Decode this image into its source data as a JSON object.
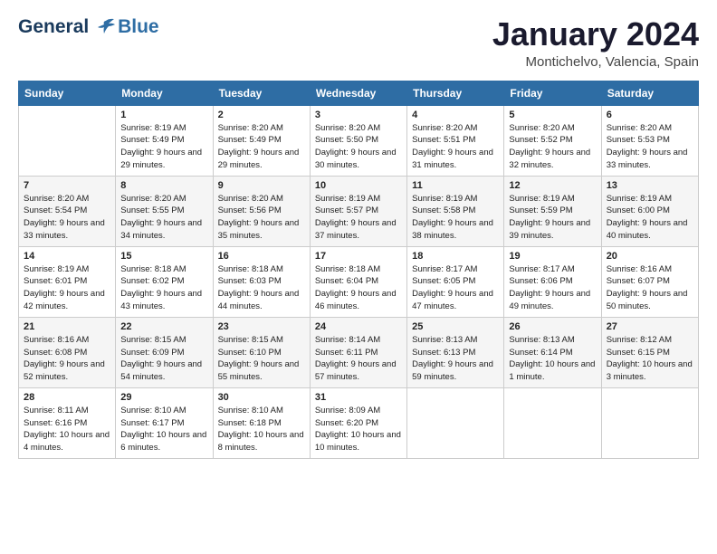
{
  "logo": {
    "line1": "General",
    "line2": "Blue"
  },
  "title": "January 2024",
  "subtitle": "Montichelvo, Valencia, Spain",
  "days_of_week": [
    "Sunday",
    "Monday",
    "Tuesday",
    "Wednesday",
    "Thursday",
    "Friday",
    "Saturday"
  ],
  "weeks": [
    [
      {
        "num": "",
        "sunrise": "",
        "sunset": "",
        "daylight": ""
      },
      {
        "num": "1",
        "sunrise": "Sunrise: 8:19 AM",
        "sunset": "Sunset: 5:49 PM",
        "daylight": "Daylight: 9 hours and 29 minutes."
      },
      {
        "num": "2",
        "sunrise": "Sunrise: 8:20 AM",
        "sunset": "Sunset: 5:49 PM",
        "daylight": "Daylight: 9 hours and 29 minutes."
      },
      {
        "num": "3",
        "sunrise": "Sunrise: 8:20 AM",
        "sunset": "Sunset: 5:50 PM",
        "daylight": "Daylight: 9 hours and 30 minutes."
      },
      {
        "num": "4",
        "sunrise": "Sunrise: 8:20 AM",
        "sunset": "Sunset: 5:51 PM",
        "daylight": "Daylight: 9 hours and 31 minutes."
      },
      {
        "num": "5",
        "sunrise": "Sunrise: 8:20 AM",
        "sunset": "Sunset: 5:52 PM",
        "daylight": "Daylight: 9 hours and 32 minutes."
      },
      {
        "num": "6",
        "sunrise": "Sunrise: 8:20 AM",
        "sunset": "Sunset: 5:53 PM",
        "daylight": "Daylight: 9 hours and 33 minutes."
      }
    ],
    [
      {
        "num": "7",
        "sunrise": "Sunrise: 8:20 AM",
        "sunset": "Sunset: 5:54 PM",
        "daylight": "Daylight: 9 hours and 33 minutes."
      },
      {
        "num": "8",
        "sunrise": "Sunrise: 8:20 AM",
        "sunset": "Sunset: 5:55 PM",
        "daylight": "Daylight: 9 hours and 34 minutes."
      },
      {
        "num": "9",
        "sunrise": "Sunrise: 8:20 AM",
        "sunset": "Sunset: 5:56 PM",
        "daylight": "Daylight: 9 hours and 35 minutes."
      },
      {
        "num": "10",
        "sunrise": "Sunrise: 8:19 AM",
        "sunset": "Sunset: 5:57 PM",
        "daylight": "Daylight: 9 hours and 37 minutes."
      },
      {
        "num": "11",
        "sunrise": "Sunrise: 8:19 AM",
        "sunset": "Sunset: 5:58 PM",
        "daylight": "Daylight: 9 hours and 38 minutes."
      },
      {
        "num": "12",
        "sunrise": "Sunrise: 8:19 AM",
        "sunset": "Sunset: 5:59 PM",
        "daylight": "Daylight: 9 hours and 39 minutes."
      },
      {
        "num": "13",
        "sunrise": "Sunrise: 8:19 AM",
        "sunset": "Sunset: 6:00 PM",
        "daylight": "Daylight: 9 hours and 40 minutes."
      }
    ],
    [
      {
        "num": "14",
        "sunrise": "Sunrise: 8:19 AM",
        "sunset": "Sunset: 6:01 PM",
        "daylight": "Daylight: 9 hours and 42 minutes."
      },
      {
        "num": "15",
        "sunrise": "Sunrise: 8:18 AM",
        "sunset": "Sunset: 6:02 PM",
        "daylight": "Daylight: 9 hours and 43 minutes."
      },
      {
        "num": "16",
        "sunrise": "Sunrise: 8:18 AM",
        "sunset": "Sunset: 6:03 PM",
        "daylight": "Daylight: 9 hours and 44 minutes."
      },
      {
        "num": "17",
        "sunrise": "Sunrise: 8:18 AM",
        "sunset": "Sunset: 6:04 PM",
        "daylight": "Daylight: 9 hours and 46 minutes."
      },
      {
        "num": "18",
        "sunrise": "Sunrise: 8:17 AM",
        "sunset": "Sunset: 6:05 PM",
        "daylight": "Daylight: 9 hours and 47 minutes."
      },
      {
        "num": "19",
        "sunrise": "Sunrise: 8:17 AM",
        "sunset": "Sunset: 6:06 PM",
        "daylight": "Daylight: 9 hours and 49 minutes."
      },
      {
        "num": "20",
        "sunrise": "Sunrise: 8:16 AM",
        "sunset": "Sunset: 6:07 PM",
        "daylight": "Daylight: 9 hours and 50 minutes."
      }
    ],
    [
      {
        "num": "21",
        "sunrise": "Sunrise: 8:16 AM",
        "sunset": "Sunset: 6:08 PM",
        "daylight": "Daylight: 9 hours and 52 minutes."
      },
      {
        "num": "22",
        "sunrise": "Sunrise: 8:15 AM",
        "sunset": "Sunset: 6:09 PM",
        "daylight": "Daylight: 9 hours and 54 minutes."
      },
      {
        "num": "23",
        "sunrise": "Sunrise: 8:15 AM",
        "sunset": "Sunset: 6:10 PM",
        "daylight": "Daylight: 9 hours and 55 minutes."
      },
      {
        "num": "24",
        "sunrise": "Sunrise: 8:14 AM",
        "sunset": "Sunset: 6:11 PM",
        "daylight": "Daylight: 9 hours and 57 minutes."
      },
      {
        "num": "25",
        "sunrise": "Sunrise: 8:13 AM",
        "sunset": "Sunset: 6:13 PM",
        "daylight": "Daylight: 9 hours and 59 minutes."
      },
      {
        "num": "26",
        "sunrise": "Sunrise: 8:13 AM",
        "sunset": "Sunset: 6:14 PM",
        "daylight": "Daylight: 10 hours and 1 minute."
      },
      {
        "num": "27",
        "sunrise": "Sunrise: 8:12 AM",
        "sunset": "Sunset: 6:15 PM",
        "daylight": "Daylight: 10 hours and 3 minutes."
      }
    ],
    [
      {
        "num": "28",
        "sunrise": "Sunrise: 8:11 AM",
        "sunset": "Sunset: 6:16 PM",
        "daylight": "Daylight: 10 hours and 4 minutes."
      },
      {
        "num": "29",
        "sunrise": "Sunrise: 8:10 AM",
        "sunset": "Sunset: 6:17 PM",
        "daylight": "Daylight: 10 hours and 6 minutes."
      },
      {
        "num": "30",
        "sunrise": "Sunrise: 8:10 AM",
        "sunset": "Sunset: 6:18 PM",
        "daylight": "Daylight: 10 hours and 8 minutes."
      },
      {
        "num": "31",
        "sunrise": "Sunrise: 8:09 AM",
        "sunset": "Sunset: 6:20 PM",
        "daylight": "Daylight: 10 hours and 10 minutes."
      },
      {
        "num": "",
        "sunrise": "",
        "sunset": "",
        "daylight": ""
      },
      {
        "num": "",
        "sunrise": "",
        "sunset": "",
        "daylight": ""
      },
      {
        "num": "",
        "sunrise": "",
        "sunset": "",
        "daylight": ""
      }
    ]
  ]
}
